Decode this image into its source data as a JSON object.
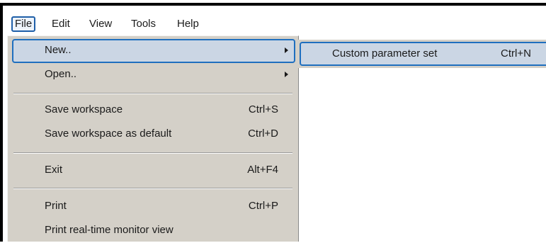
{
  "menubar": {
    "items": [
      {
        "label": "File",
        "active": true
      },
      {
        "label": "Edit"
      },
      {
        "label": "View"
      },
      {
        "label": "Tools"
      },
      {
        "label": "Help"
      }
    ]
  },
  "file_menu": {
    "new": {
      "label": "New..",
      "has_submenu": true
    },
    "open": {
      "label": "Open..",
      "has_submenu": true
    },
    "save_workspace": {
      "label": "Save workspace",
      "shortcut": "Ctrl+S"
    },
    "save_workspace_default": {
      "label": "Save workspace as default",
      "shortcut": "Ctrl+D"
    },
    "exit": {
      "label": "Exit",
      "shortcut": "Alt+F4"
    },
    "print": {
      "label": "Print",
      "shortcut": "Ctrl+P"
    },
    "print_monitor": {
      "label": "Print real-time monitor view"
    }
  },
  "new_submenu": {
    "custom_parameter_set": {
      "label": "Custom parameter set",
      "shortcut": "Ctrl+N"
    }
  },
  "colors": {
    "menu_background": "#d4d0c8",
    "highlight_border": "#1f6fbf",
    "highlight_fill": "#cbd6e4",
    "frame": "#000000"
  }
}
